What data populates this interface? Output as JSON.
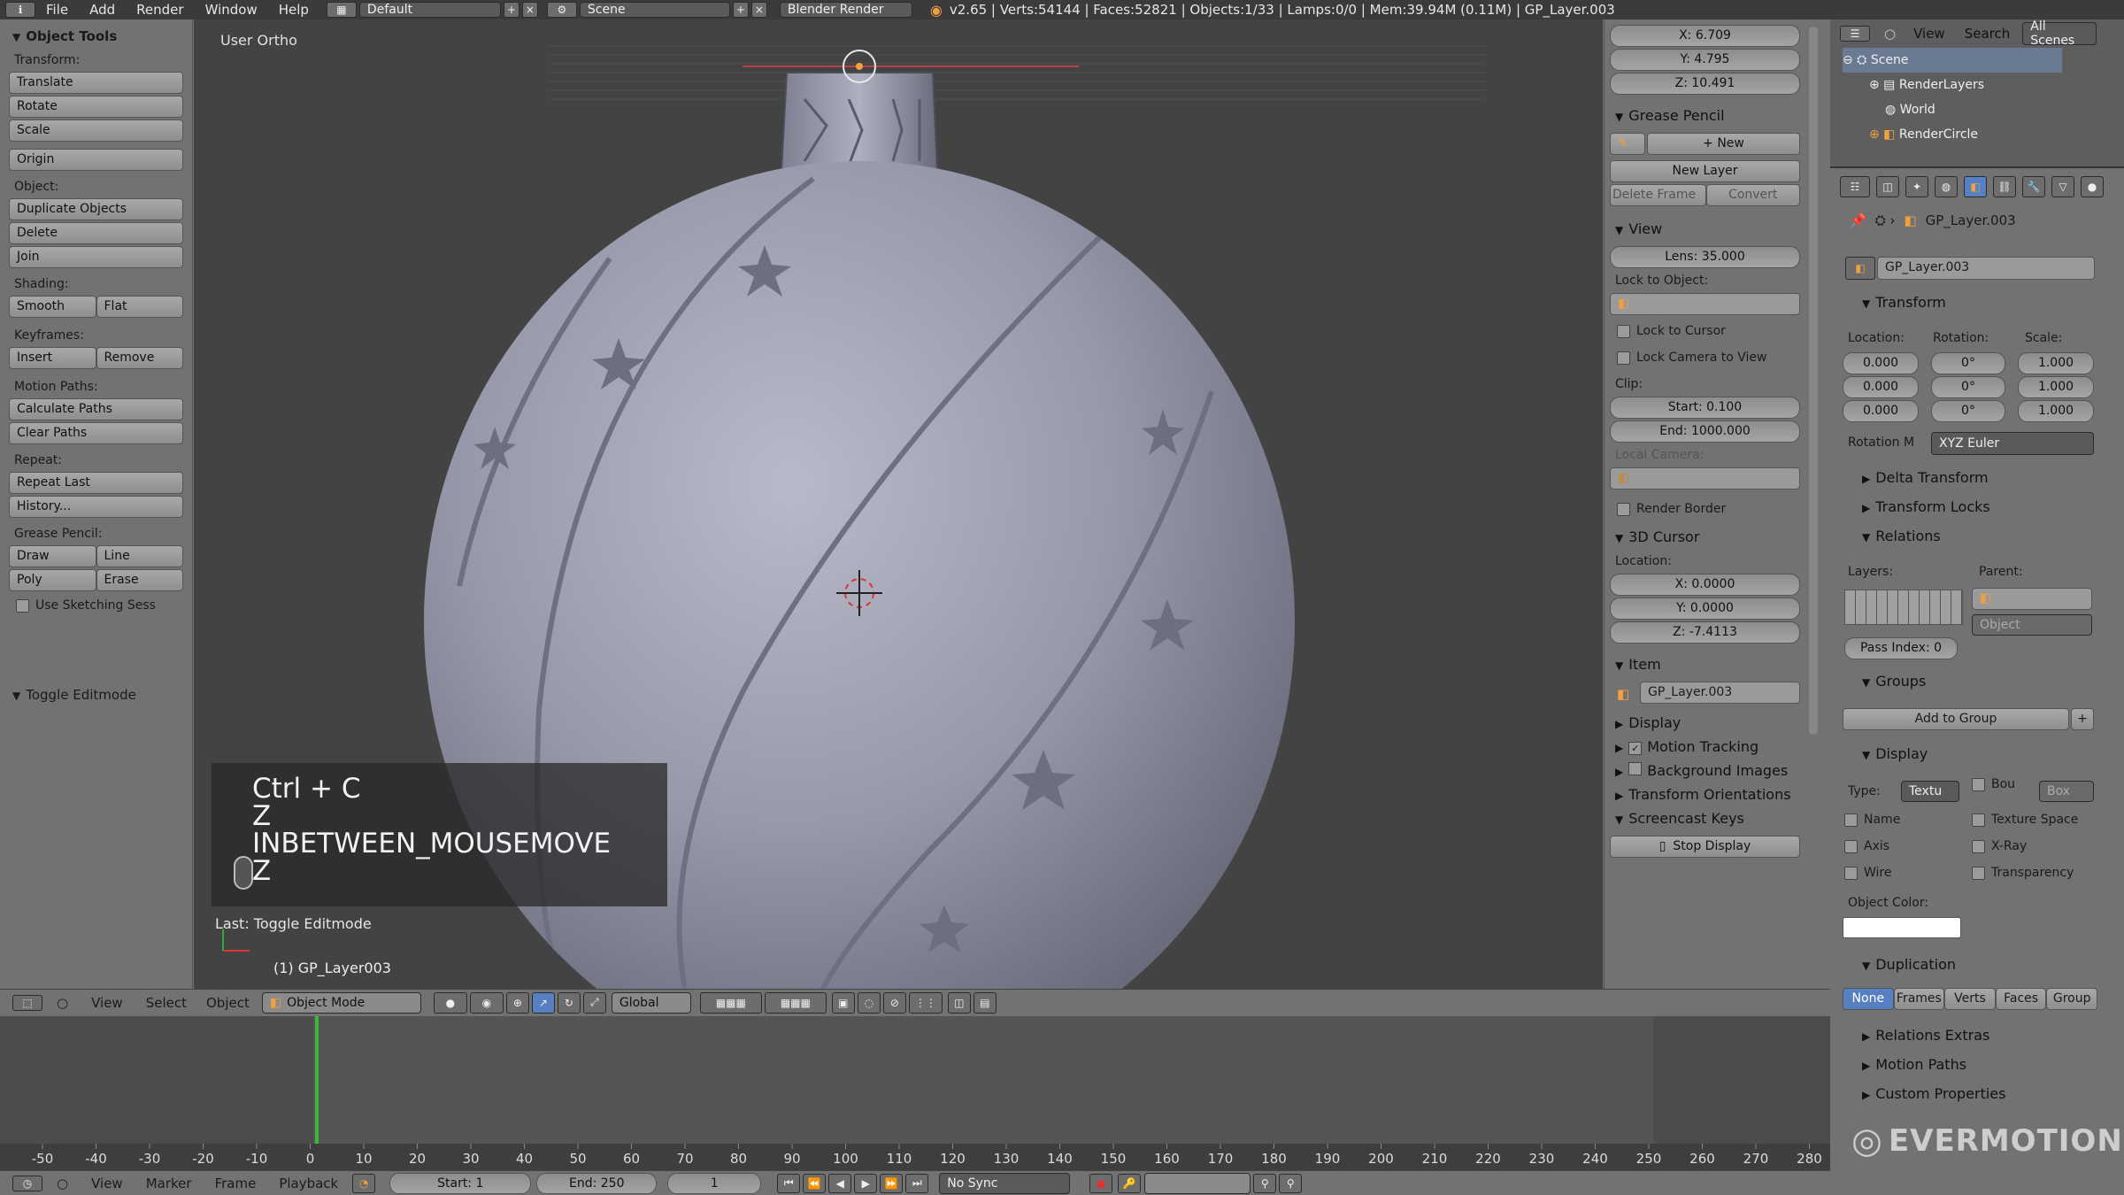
{
  "menubar": {
    "items": [
      "File",
      "Add",
      "Render",
      "Window",
      "Help"
    ],
    "screen": "Default",
    "scene": "Scene",
    "engine": "Blender Render",
    "info": "v2.65 | Verts:54144 | Faces:52821 | Objects:1/33 | Lamps:0/0 | Mem:39.94M (0.11M) | GP_Layer.003"
  },
  "toolshelf": {
    "title": "Object Tools",
    "transform_label": "Transform:",
    "translate": "Translate",
    "rotate": "Rotate",
    "scale": "Scale",
    "origin": "Origin",
    "object_label": "Object:",
    "duplicate": "Duplicate Objects",
    "delete": "Delete",
    "join": "Join",
    "shading_label": "Shading:",
    "smooth": "Smooth",
    "flat": "Flat",
    "keyframes_label": "Keyframes:",
    "insert": "Insert",
    "remove": "Remove",
    "motion_label": "Motion Paths:",
    "calc_paths": "Calculate Paths",
    "clear_paths": "Clear Paths",
    "repeat_label": "Repeat:",
    "repeat_last": "Repeat Last",
    "history": "History...",
    "gp_label": "Grease Pencil:",
    "draw": "Draw",
    "line": "Line",
    "poly": "Poly",
    "erase": "Erase",
    "sketch": "Use Sketching Sess",
    "toggle_editmode": "Toggle Editmode"
  },
  "viewport": {
    "label": "User Ortho",
    "screencast": [
      "Ctrl + C",
      "Z",
      "INBETWEEN_MOUSEMOVE",
      "Z"
    ],
    "last_op": "Last: Toggle Editmode",
    "object_name": "(1) GP_Layer003"
  },
  "props": {
    "x": "X: 6.709",
    "y": "Y: 4.795",
    "z": "Z: 10.491",
    "grease_pencil": "Grease Pencil",
    "new": "New",
    "new_layer": "New Layer",
    "delete_frame": "Delete Frame",
    "convert": "Convert",
    "view": "View",
    "lens": "Lens: 35.000",
    "lock_to_object": "Lock to Object:",
    "lock_cursor": "Lock to Cursor",
    "lock_camera": "Lock Camera to View",
    "clip": "Clip:",
    "clip_start": "Start: 0.100",
    "clip_end": "End: 1000.000",
    "local_camera": "Local Camera:",
    "render_border": "Render Border",
    "cursor_3d": "3D Cursor",
    "location": "Location:",
    "cx": "X: 0.0000",
    "cy": "Y: 0.0000",
    "cz": "Z: -7.4113",
    "item": "Item",
    "item_name": "GP_Layer.003",
    "display": "Display",
    "motion_tracking": "Motion Tracking",
    "background_images": "Background Images",
    "transform_orientations": "Transform Orientations",
    "screencast_keys": "Screencast Keys",
    "stop_display": "Stop Display"
  },
  "outliner": {
    "view": "View",
    "search": "Search",
    "all_scenes": "All Scenes",
    "items": [
      "Scene",
      "RenderLayers",
      "World",
      "RenderCircle"
    ]
  },
  "object_props": {
    "breadcrumb": "GP_Layer.003",
    "name": "GP_Layer.003",
    "transform": "Transform",
    "location": "Location:",
    "rotation": "Rotation:",
    "scale": "Scale:",
    "loc": [
      "0.000",
      "0.000",
      "0.000"
    ],
    "rot": [
      "0°",
      "0°",
      "0°"
    ],
    "scl": [
      "1.000",
      "1.000",
      "1.000"
    ],
    "rotation_mode_label": "Rotation M",
    "rotation_mode": "XYZ Euler",
    "delta_transform": "Delta Transform",
    "transform_locks": "Transform Locks",
    "relations": "Relations",
    "layers": "Layers:",
    "parent": "Parent:",
    "parent_type": "Object",
    "pass_index": "Pass Index: 0",
    "groups": "Groups",
    "add_to_group": "Add to Group",
    "display": "Display",
    "type_label": "Type:",
    "type": "Textu",
    "bounds": "Bou",
    "bounds_type": "Box",
    "name_chk": "Name",
    "texture_space": "Texture Space",
    "axis": "Axis",
    "xray": "X-Ray",
    "wire": "Wire",
    "transparency": "Transparency",
    "object_color": "Object Color:",
    "duplication": "Duplication",
    "dup_opts": [
      "None",
      "Frames",
      "Verts",
      "Faces",
      "Group"
    ],
    "relations_extras": "Relations Extras",
    "motion_paths": "Motion Paths",
    "custom_properties": "Custom Properties",
    "logo": "EVERMOTION"
  },
  "view_header": {
    "view": "View",
    "select": "Select",
    "object": "Object",
    "mode": "Object Mode",
    "orientation": "Global"
  },
  "timeline": {
    "ticks": [
      "-50",
      "-40",
      "-30",
      "-20",
      "-10",
      "0",
      "10",
      "20",
      "30",
      "40",
      "50",
      "60",
      "70",
      "80",
      "90",
      "100",
      "110",
      "120",
      "130",
      "140",
      "150",
      "160",
      "170",
      "180",
      "190",
      "200",
      "210",
      "220",
      "230",
      "240",
      "250",
      "260",
      "270",
      "280"
    ],
    "current_frame": 1
  },
  "bottom": {
    "view": "View",
    "marker": "Marker",
    "frame": "Frame",
    "playback": "Playback",
    "start": "Start: 1",
    "end": "End: 250",
    "current": "1",
    "sync": "No Sync"
  },
  "colors": {
    "accent_blue": "#5680c2",
    "active_object": "#f0a040",
    "frame_marker": "#3fb63f"
  }
}
